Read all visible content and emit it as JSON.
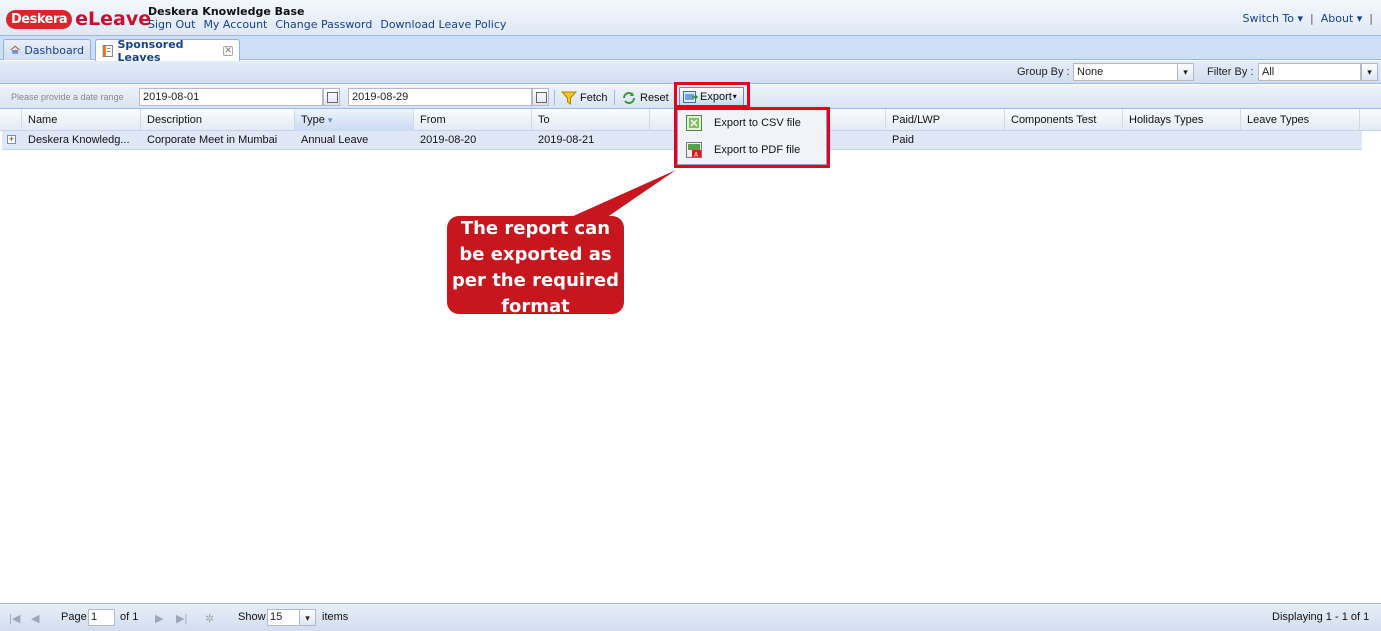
{
  "header": {
    "logo_badge": "Deskera",
    "logo_text": "eLeave",
    "company": "Deskera Knowledge Base",
    "links": [
      "Sign Out",
      "My Account",
      "Change Password",
      "Download Leave Policy"
    ],
    "switch_to": "Switch To ▾",
    "about": "About ▾",
    "sep": "|"
  },
  "tabs": [
    {
      "label": "Dashboard"
    },
    {
      "label": "Sponsored Leaves",
      "close": "✕"
    }
  ],
  "groupbar": {
    "group_by_label": "Group By :",
    "group_by_value": "None",
    "filter_by_label": "Filter By :",
    "filter_by_value": "All"
  },
  "toolbar": {
    "hint": "Please provide a date range",
    "from_date": "2019-08-01",
    "to_date": "2019-08-29",
    "fetch": "Fetch",
    "reset": "Reset",
    "export": "Export"
  },
  "export_menu": {
    "csv": "Export to CSV file",
    "pdf": "Export to PDF file"
  },
  "grid": {
    "columns": [
      "Name",
      "Description",
      "Type",
      "From",
      "To",
      "",
      "Paid/LWP",
      "Components Test",
      "Holidays Types",
      "Leave Types"
    ],
    "rows": [
      [
        "Deskera Knowledg...",
        "Corporate Meet in Mumbai",
        "Annual Leave",
        "2019-08-20",
        "2019-08-21",
        "",
        "Paid",
        "",
        "",
        ""
      ]
    ]
  },
  "callout": {
    "line1": "The report can",
    "line2": "be exported as",
    "line3": "per the required",
    "line4": "format"
  },
  "statusbar": {
    "page_label": "Page",
    "page_value": "1",
    "of_label": "of 1",
    "show_label": "Show",
    "show_value": "15",
    "items_label": "items",
    "displaying": "Displaying 1 - 1 of 1"
  },
  "colors": {
    "accent": "#15428b",
    "highlight": "#e8001c",
    "callout": "#c8161e"
  }
}
